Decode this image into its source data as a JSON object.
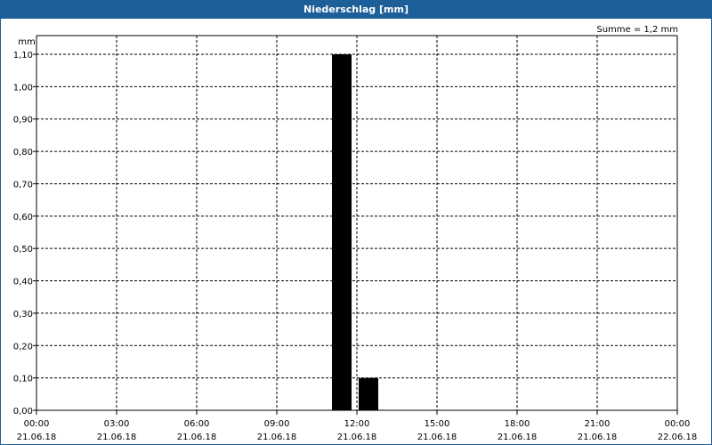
{
  "window": {
    "title": "Niederschlag [mm]"
  },
  "chart_data": {
    "type": "bar",
    "title": "Niederschlag [mm]",
    "ylabel": "mm",
    "summary": "Summe = 1,2 mm",
    "ylim": [
      0,
      1.1
    ],
    "yticks": [
      "0,00",
      "0,10",
      "0,20",
      "0,30",
      "0,40",
      "0,50",
      "0,60",
      "0,70",
      "0,80",
      "0,90",
      "1,00",
      "1,10"
    ],
    "xticks": [
      {
        "time": "00:00",
        "date": "21.06.18"
      },
      {
        "time": "03:00",
        "date": "21.06.18"
      },
      {
        "time": "06:00",
        "date": "21.06.18"
      },
      {
        "time": "09:00",
        "date": "21.06.18"
      },
      {
        "time": "12:00",
        "date": "21.06.18"
      },
      {
        "time": "15:00",
        "date": "21.06.18"
      },
      {
        "time": "18:00",
        "date": "21.06.18"
      },
      {
        "time": "21:00",
        "date": "21.06.18"
      },
      {
        "time": "00:00",
        "date": "22.06.18"
      }
    ],
    "xlim_hours": [
      0,
      24
    ],
    "grid": true,
    "bars": [
      {
        "start_hour": 11,
        "end_hour": 12,
        "value": 1.1
      },
      {
        "start_hour": 12,
        "end_hour": 13,
        "value": 0.1
      }
    ],
    "bar_color": "#000000"
  }
}
